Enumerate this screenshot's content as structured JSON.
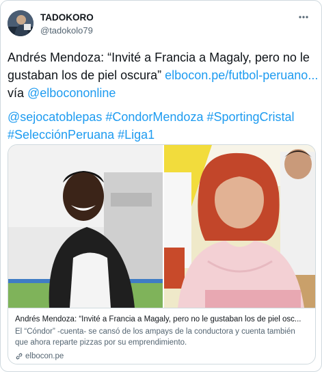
{
  "author": {
    "name": "TADOKORO",
    "handle": "@tadokolo79"
  },
  "tweet": {
    "text_prefix": "Andrés Mendoza: “Invité a Francia a Magaly, pero no le gustaban los de piel oscura” ",
    "link_text": "elbocon.pe/futbol-peruano...",
    "via_text": " vía ",
    "via_mention": "@elbocononline",
    "hashtags": "@sejocatoblepas #CondorMendoza #SportingCristal #SelecciónPeruana #Liga1"
  },
  "card": {
    "title": "Andrés Mendoza: “Invité a Francia a Magaly, pero no le gustaban los de piel osc...",
    "description": "El “Cóndor” -cuenta- se cansó de los ampays de la conductora y cuenta también que ahora reparte pizzas por su emprendimiento.",
    "domain": "elbocon.pe"
  },
  "colors": {
    "link": "#1d9bf0",
    "secondary_text": "#536471",
    "border": "#cfd9de"
  },
  "icons": [
    "more-options-icon",
    "link-icon"
  ]
}
